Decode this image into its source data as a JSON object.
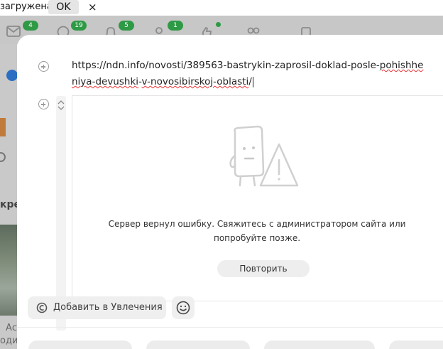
{
  "notice": {
    "text": "загружена",
    "ok_label": "OK",
    "close_symbol": "×"
  },
  "topbar": {
    "icons": [
      "mail-icon",
      "discussions-icon",
      "notifications-icon",
      "guests-icon",
      "likes-icon",
      "friends-icon",
      "video-icon"
    ],
    "badges": {
      "mail": "4",
      "discussions": "19",
      "notifications": "5",
      "guests": "1"
    },
    "accent": "#2f9a46"
  },
  "leftcol": {
    "heading_fragment": "кре",
    "text_a": "Ас",
    "text_b": "оди"
  },
  "editor": {
    "url_main": "https://ndn.info/novosti/389563-bastrykin-zaprosil-doklad-posle-",
    "url_err1": "pohishheniya-devushki",
    "url_dash": "-",
    "url_err2": "v-novosibirskoj-oblasti",
    "url_tail": "/"
  },
  "embed": {
    "error_text": "Сервер вернул ошибку. Свяжитесь с администратором сайта или попробуйте позже.",
    "retry_label": "Повторить"
  },
  "actions": {
    "add_interest_label": "Добавить в Увлечения"
  }
}
